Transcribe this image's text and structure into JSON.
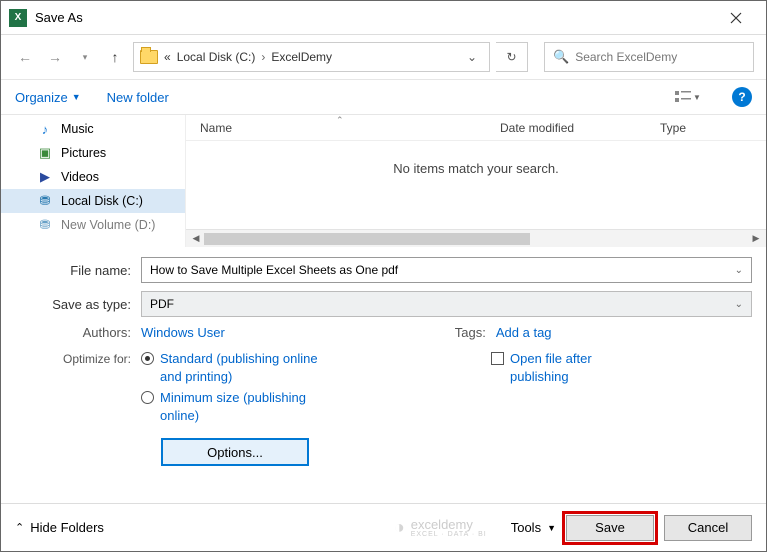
{
  "window": {
    "title": "Save As"
  },
  "nav": {
    "crumb_prefix": "«",
    "crumb1": "Local Disk (C:)",
    "crumb2": "ExcelDemy",
    "search_placeholder": "Search ExcelDemy"
  },
  "toolbar": {
    "organize": "Organize",
    "newfolder": "New folder"
  },
  "sidebar": {
    "items": [
      {
        "label": "Music"
      },
      {
        "label": "Pictures"
      },
      {
        "label": "Videos"
      },
      {
        "label": "Local Disk (C:)"
      },
      {
        "label": "New Volume (D:)"
      }
    ]
  },
  "columns": {
    "name": "Name",
    "date": "Date modified",
    "type": "Type"
  },
  "list": {
    "empty": "No items match your search."
  },
  "form": {
    "filename_label": "File name:",
    "filename_value": "How to Save Multiple Excel Sheets as One pdf",
    "savetype_label": "Save as type:",
    "savetype_value": "PDF",
    "authors_label": "Authors:",
    "authors_value": "Windows User",
    "tags_label": "Tags:",
    "tags_value": "Add a tag",
    "optimize_label": "Optimize for:",
    "opt_standard": "Standard (publishing online and printing)",
    "opt_minimum": "Minimum size (publishing online)",
    "open_after": "Open file after publishing",
    "options_btn": "Options..."
  },
  "footer": {
    "hide": "Hide Folders",
    "watermark": "exceldemy",
    "watermark_sub": "EXCEL · DATA · BI",
    "tools": "Tools",
    "save": "Save",
    "cancel": "Cancel"
  }
}
